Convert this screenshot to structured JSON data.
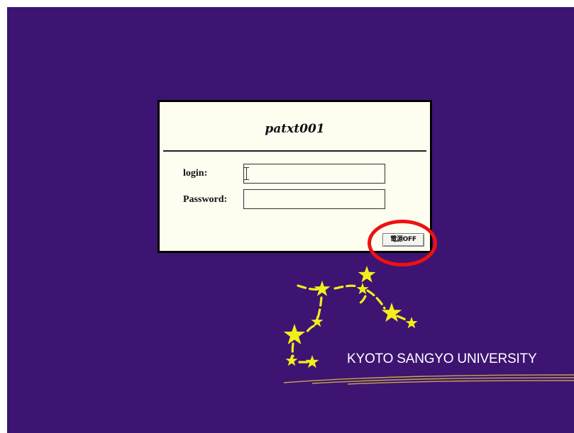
{
  "login_dialog": {
    "host_title": "patxt001",
    "login_label": "login:",
    "login_value": "",
    "password_label": "Password:",
    "password_value": "",
    "power_off_button": "電源OFF"
  },
  "branding": {
    "university_name": "KYOTO SANGYO UNIVERSITY",
    "logo": "star-constellation-logo"
  },
  "colors": {
    "background": "#3d1472",
    "dialog_background": "#fdfdf0",
    "logo_yellow": "#f2ee1c",
    "highlight_circle": "#ee1111",
    "accent_lines": "#c8a64a"
  }
}
